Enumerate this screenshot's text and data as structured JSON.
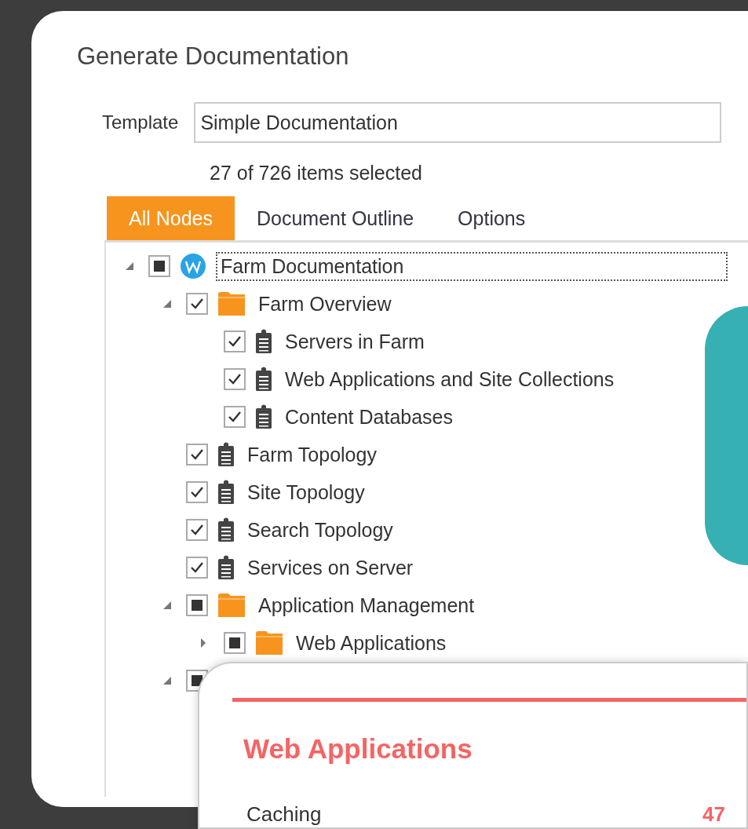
{
  "dialog": {
    "title": "Generate Documentation",
    "template": {
      "label": "Template",
      "value": "Simple Documentation"
    },
    "selection_summary": "27 of 726 items selected",
    "tabs": [
      {
        "label": "All Nodes",
        "selected": true
      },
      {
        "label": "Document Outline",
        "selected": false
      },
      {
        "label": "Options",
        "selected": false
      }
    ],
    "tree": [
      {
        "label": "Farm Documentation",
        "kind": "web",
        "checked": true,
        "partial": true,
        "expanded": true,
        "focused": true,
        "children": [
          {
            "label": "Farm Overview",
            "kind": "folder",
            "checked": true,
            "partial": false,
            "expanded": true,
            "children": [
              {
                "label": "Servers in Farm",
                "kind": "document",
                "checked": true,
                "partial": false
              },
              {
                "label": "Web Applications and Site Collections",
                "kind": "document",
                "checked": true,
                "partial": false
              },
              {
                "label": "Content Databases",
                "kind": "document",
                "checked": true,
                "partial": false
              }
            ]
          },
          {
            "label": "Farm Topology",
            "kind": "document",
            "checked": true,
            "partial": false
          },
          {
            "label": "Site Topology",
            "kind": "document",
            "checked": true,
            "partial": false
          },
          {
            "label": "Search Topology",
            "kind": "document",
            "checked": true,
            "partial": false
          },
          {
            "label": "Services on Server",
            "kind": "document",
            "checked": true,
            "partial": false
          },
          {
            "label": "Application Management",
            "kind": "folder",
            "checked": true,
            "partial": true,
            "expanded": true,
            "children": [
              {
                "label": "Web Applications",
                "kind": "folder",
                "checked": true,
                "partial": true,
                "expanded": false
              }
            ]
          },
          {
            "kind": "none",
            "checked": true,
            "partial": true,
            "expanded": true
          }
        ]
      }
    ]
  },
  "popup_card": {
    "title": "Web Applications",
    "rows": [
      {
        "label": "Caching",
        "value": "47"
      }
    ]
  }
}
